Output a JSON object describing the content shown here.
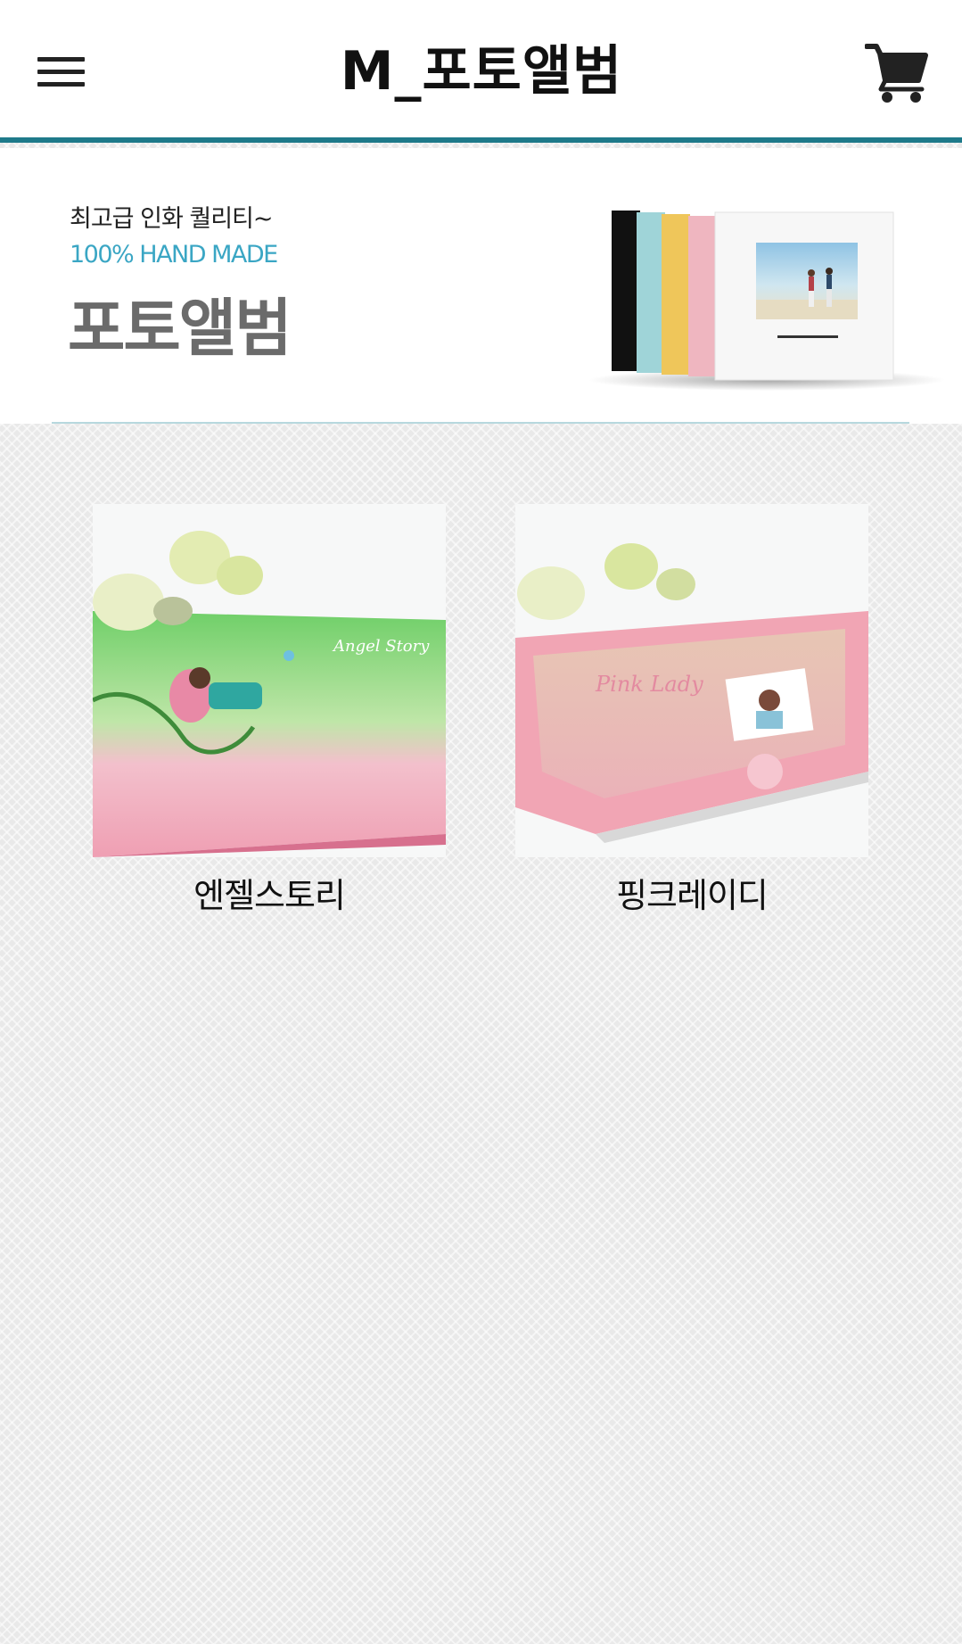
{
  "header": {
    "title": "M_포토앨범",
    "menu_icon": "hamburger-menu-icon",
    "cart_icon": "shopping-cart-icon",
    "accent_color": "#1e7a8a"
  },
  "banner": {
    "subtitle_1": "최고급 인화 퀄리티~",
    "subtitle_2": "100% HAND MADE",
    "title": "포토앨범",
    "subtitle_2_color": "#3aa6c4",
    "title_color": "#6b6b6b"
  },
  "products": [
    {
      "name": "엔젤스토리"
    },
    {
      "name": "핑크레이디"
    }
  ]
}
